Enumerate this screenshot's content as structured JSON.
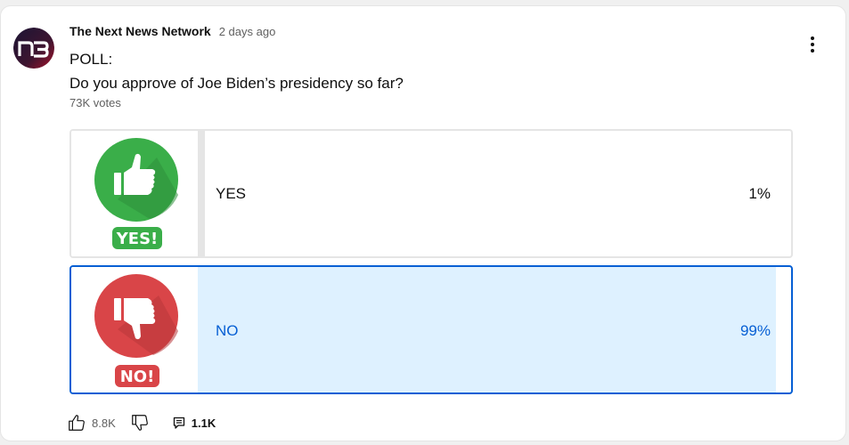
{
  "post": {
    "channel_name": "The Next News Network",
    "channel_logo_text": "n3",
    "time_ago": "2 days ago",
    "text_line1": "POLL:",
    "text_line2": "Do you approve of Joe Biden’s presidency so far?",
    "votes": "73K votes"
  },
  "poll": {
    "options": [
      {
        "label": "YES",
        "percent_text": "1%",
        "fraction": 0.01,
        "badge": "YES!",
        "icon": "thumbs-up-icon",
        "color": "#3aae49",
        "selected": false
      },
      {
        "label": "NO",
        "percent_text": "99%",
        "fraction": 0.99,
        "badge": "NO!",
        "icon": "thumbs-down-icon",
        "color": "#d94548",
        "selected": true
      }
    ]
  },
  "actions": {
    "likes": "8.8K",
    "comments": "1.1K"
  },
  "colors": {
    "accent": "#065fd4",
    "selected_fill": "#def1ff",
    "unselected_fill": "#e5e5e5",
    "yes_green": "#3aae49",
    "no_red": "#d94548"
  }
}
